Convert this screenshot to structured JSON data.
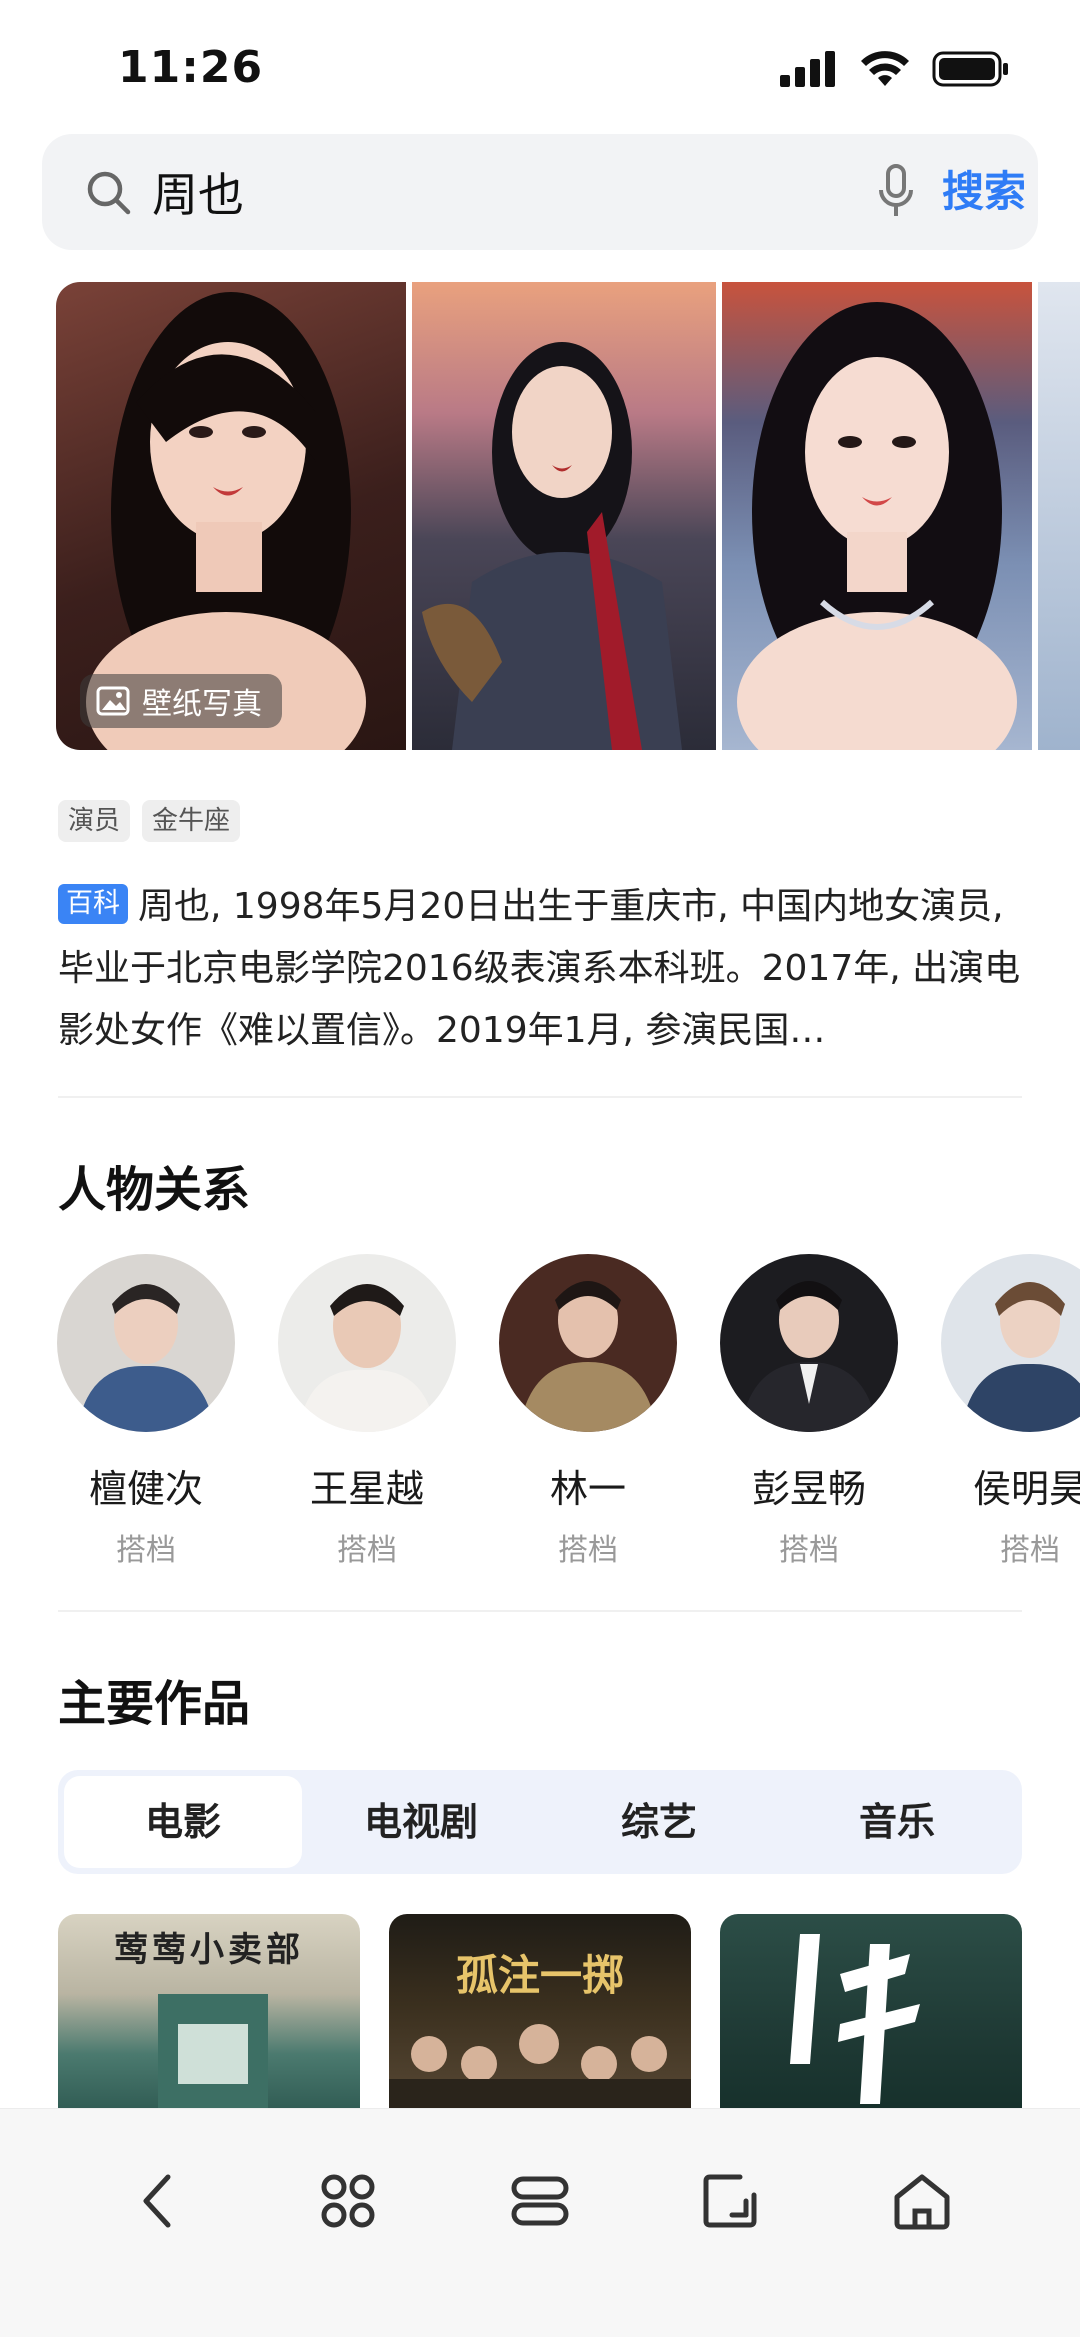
{
  "status_bar": {
    "time": "11:26"
  },
  "search": {
    "query": "周也",
    "button_label": "搜索"
  },
  "gallery": {
    "badge_label": "壁纸写真"
  },
  "tags": [
    "演员",
    "金牛座"
  ],
  "summary": {
    "badge": "百科",
    "text": "周也, 1998年5月20日出生于重庆市, 中国内地女演员, 毕业于北京电影学院2016级表演系本科班。2017年, 出演电影处女作《难以置信》。2019年1月, 参演民国…"
  },
  "relations": {
    "title": "人物关系",
    "people": [
      {
        "name": "檀健次",
        "role": "搭档"
      },
      {
        "name": "王星越",
        "role": "搭档"
      },
      {
        "name": "林一",
        "role": "搭档"
      },
      {
        "name": "彭昱畅",
        "role": "搭档"
      },
      {
        "name": "侯明昊",
        "role": "搭档"
      }
    ]
  },
  "works": {
    "title": "主要作品",
    "tabs": [
      "电影",
      "电视剧",
      "综艺",
      "音乐"
    ],
    "active_tab": "电影",
    "posters": [
      {
        "title": "莺莺小卖部"
      },
      {
        "title": "孤注一掷"
      },
      {
        "title": ""
      }
    ]
  },
  "nav": [
    "back-icon",
    "apps-icon",
    "tabs-icon",
    "edit-icon",
    "home-icon"
  ],
  "colors": {
    "accent": "#2f7cf6",
    "baike": "#3a84f5"
  }
}
